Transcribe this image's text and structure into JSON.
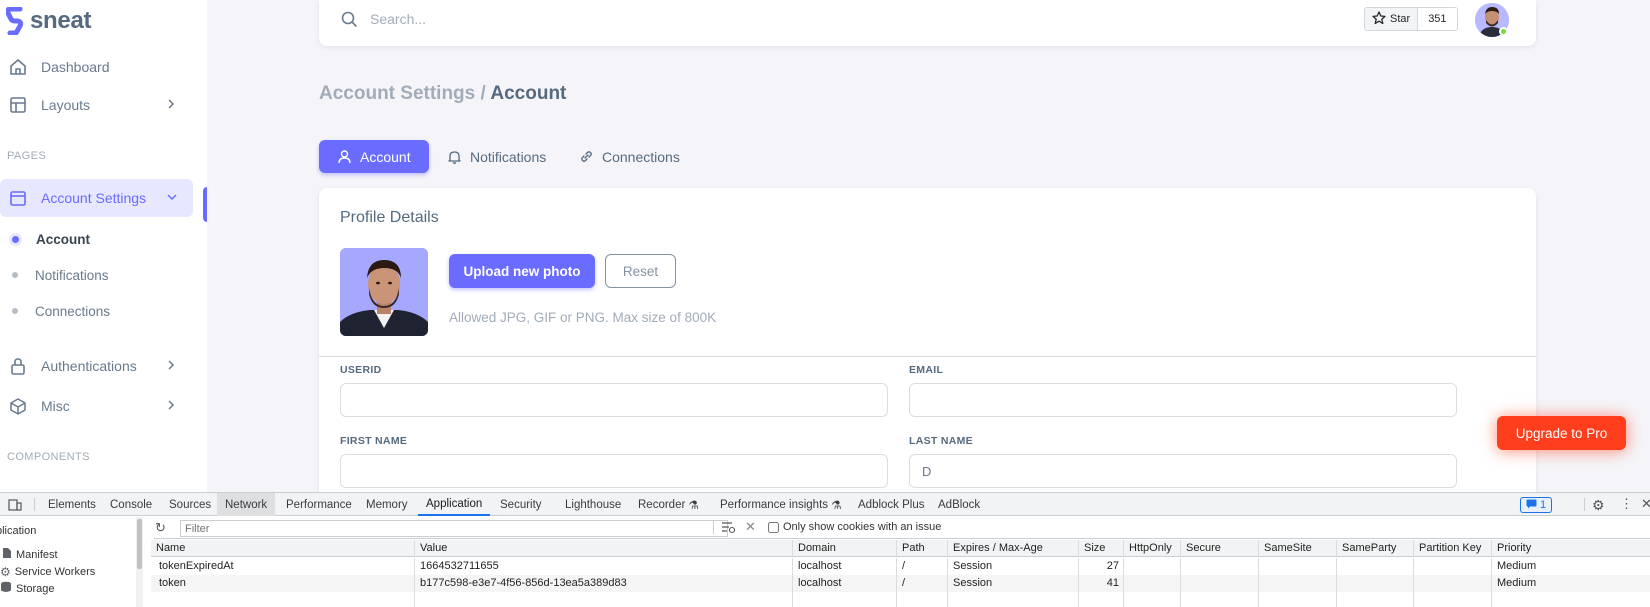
{
  "brand": {
    "name": "sneat",
    "color": "#696cff"
  },
  "sidebar": {
    "items": [
      {
        "label": "Dashboard",
        "icon": "home-icon"
      },
      {
        "label": "Layouts",
        "icon": "layout-icon"
      },
      {
        "label": "Account Settings",
        "icon": "dock-icon",
        "active": true
      },
      {
        "label": "Authentications",
        "icon": "lock-icon"
      },
      {
        "label": "Misc",
        "icon": "cube-icon"
      }
    ],
    "sections": {
      "pages": "PAGES",
      "components": "COMPONENTS"
    },
    "subitems": [
      {
        "label": "Account",
        "active": true
      },
      {
        "label": "Notifications"
      },
      {
        "label": "Connections"
      }
    ]
  },
  "navbar": {
    "search_placeholder": "Search...",
    "star_label": "Star",
    "star_count": "351"
  },
  "page": {
    "breadcrumb_parent": "Account Settings /",
    "breadcrumb_current": "Account",
    "tabs": [
      {
        "label": "Account",
        "icon": "user-icon",
        "active": true
      },
      {
        "label": "Notifications",
        "icon": "bell-icon"
      },
      {
        "label": "Connections",
        "icon": "link-icon"
      }
    ]
  },
  "profile": {
    "title": "Profile Details",
    "upload_label": "Upload new photo",
    "reset_label": "Reset",
    "hint": "Allowed JPG, GIF or PNG. Max size of 800K"
  },
  "form": {
    "userid_label": "USERID",
    "email_label": "EMAIL",
    "first_name_label": "FIRST NAME",
    "last_name_label": "LAST NAME",
    "last_name_value": "D"
  },
  "upgrade_label": "Upgrade to Pro",
  "devtools": {
    "tabs": [
      "Elements",
      "Console",
      "Sources",
      "Network",
      "Performance",
      "Memory",
      "Application",
      "Security",
      "Lighthouse",
      "Recorder",
      "Performance insights",
      "Adblock Plus",
      "AdBlock"
    ],
    "active_tab": "Application",
    "issues_count": "1",
    "sidebar": {
      "title": "plication",
      "items": [
        "Manifest",
        "Service Workers",
        "Storage"
      ]
    },
    "filter_placeholder": "Filter",
    "only_issue_label": "Only show cookies with an issue",
    "columns": [
      "Name",
      "Value",
      "Domain",
      "Path",
      "Expires / Max-Age",
      "Size",
      "HttpOnly",
      "Secure",
      "SameSite",
      "SameParty",
      "Partition Key",
      "Priority"
    ],
    "rows": [
      [
        "tokenExpiredAt",
        "1664532711655",
        "localhost",
        "/",
        "Session",
        "27",
        "",
        "",
        "",
        "",
        "",
        "Medium"
      ],
      [
        "token",
        "b177c598-e3e7-4f56-856d-13ea5a389d83",
        "localhost",
        "/",
        "Session",
        "41",
        "",
        "",
        "",
        "",
        "",
        "Medium"
      ]
    ]
  }
}
